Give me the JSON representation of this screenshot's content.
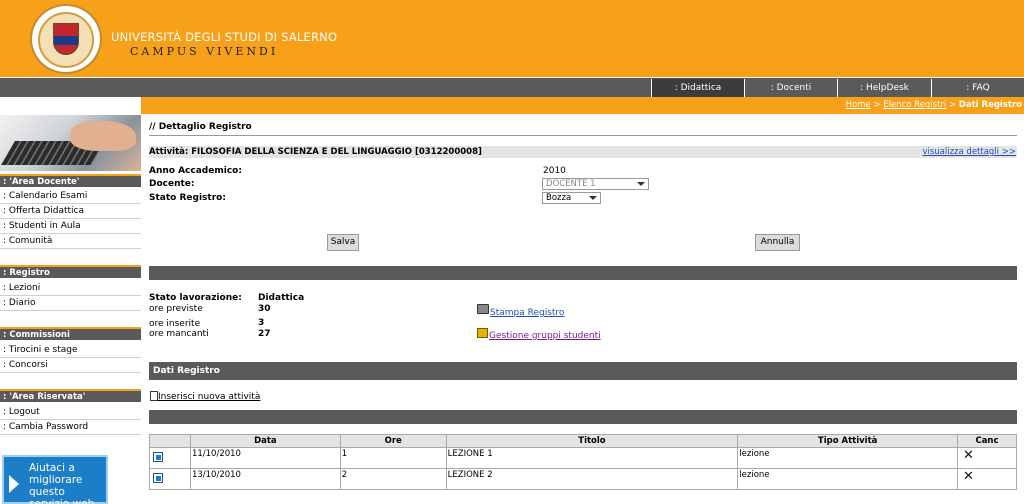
{
  "header": {
    "university": "UNIVERSITÀ DEGLI STUDI DI SALERNO",
    "campus": "CAMPUS VIVENDI",
    "logo_ring_text": "UNIVERSITAS STUDIORUM SALERNI"
  },
  "nav": {
    "tabs": [
      {
        "label": ": Didattica",
        "active": true
      },
      {
        "label": ": Docenti",
        "active": false
      },
      {
        "label": ": HelpDesk",
        "active": false
      },
      {
        "label": ": FAQ",
        "active": false
      }
    ]
  },
  "breadcrumb": {
    "home": "Home",
    "sep1": " > ",
    "elenco": "Elenco Registri",
    "sep2": " > ",
    "current": "Dati Registro"
  },
  "sidebar": {
    "area_docente": {
      "title": ": 'Area Docente'",
      "items": [
        ": Calendario Esami",
        ": Offerta Didattica",
        ": Studenti in Aula",
        ": Comunità"
      ]
    },
    "registro": {
      "title": ": Registro",
      "items": [
        ": Lezioni",
        ": Diario"
      ]
    },
    "commissioni": {
      "title": ": Commissioni",
      "items": [
        ": Tirocini e stage",
        ": Concorsi"
      ]
    },
    "area_riservata": {
      "title": ": 'Area Riservata'",
      "items": [
        ": Logout",
        ": Cambia Password"
      ]
    },
    "help": "Aiutaci a migliorare questo servizio web"
  },
  "main": {
    "page_title": "// Dettaglio Registro",
    "activity": "Attività: FILOSOFIA DELLA SCIENZA E DEL LINGUAGGIO [0312200008]",
    "details_link": "visualizza dettagli >>",
    "anno_label": "Anno Accademico:",
    "anno_value": "2010",
    "docente_label": "Docente:",
    "docente_value": "DOCENTE 1",
    "stato_label": "Stato Registro:",
    "stato_value": "Bozza",
    "save_button": "Salva",
    "cancel_button": "Annulla",
    "stato_lavorazione_label": "Stato lavorazione:",
    "stato_lavorazione_value": "Didattica",
    "ore_previste_label": "ore previste",
    "ore_previste_value": "30",
    "ore_inserite_label": "ore inserite",
    "ore_inserite_value": "3",
    "ore_mancanti_label": "ore mancanti",
    "ore_mancanti_value": "27",
    "stampa_link": "Stampa Registro",
    "gruppi_link": "Gestione gruppi studenti",
    "dati_registro_title": "Dati Registro",
    "insert_link": "Inserisci nuova attività"
  },
  "table": {
    "headers": [
      "",
      "Data",
      "Ore",
      "Titolo",
      "Tipo Attività",
      "Canc"
    ],
    "rows": [
      {
        "data": "11/10/2010",
        "ore": "1",
        "titolo": "LEZIONE 1",
        "tipo": "lezione"
      },
      {
        "data": "13/10/2010",
        "ore": "2",
        "titolo": "LEZIONE 2",
        "tipo": "lezione"
      }
    ]
  },
  "colors": {
    "orange": "#f7a11a",
    "dark_gray": "#5a5a5a",
    "link_blue": "#1f4fbf",
    "visited_purple": "#7a1a9a"
  }
}
